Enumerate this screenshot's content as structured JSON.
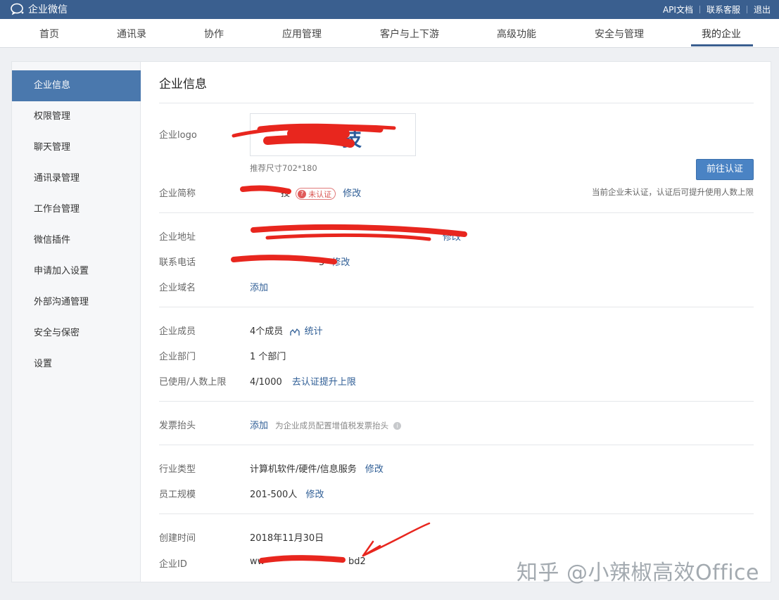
{
  "topbar": {
    "brand": "企业微信",
    "links": [
      "API文档",
      "联系客服",
      "退出"
    ]
  },
  "nav": {
    "items": [
      "首页",
      "通讯录",
      "协作",
      "应用管理",
      "客户与上下游",
      "高级功能",
      "安全与管理",
      "我的企业"
    ],
    "active": "我的企业"
  },
  "sidebar": {
    "items": [
      "企业信息",
      "权限管理",
      "聊天管理",
      "通讯录管理",
      "工作台管理",
      "微信插件",
      "申请加入设置",
      "外部沟通管理",
      "安全与保密",
      "设置"
    ],
    "active": "企业信息"
  },
  "main": {
    "title": "企业信息",
    "logo": {
      "label": "企业logo",
      "image_text": "技",
      "hint": "推荐尺寸702*180"
    },
    "certify_button": "前往认证",
    "cert_note": "当前企业未认证，认证后可提升使用人数上限",
    "short_name": {
      "label": "企业简称",
      "value": "技",
      "badge": "未认证",
      "action": "修改"
    },
    "address": {
      "label": "企业地址",
      "action": "修改"
    },
    "phone": {
      "label": "联系电话",
      "value_tail": "5",
      "action": "修改"
    },
    "domain": {
      "label": "企业域名",
      "action": "添加"
    },
    "members": {
      "label": "企业成员",
      "value": "4个成员",
      "action": "统计"
    },
    "departments": {
      "label": "企业部门",
      "value": "1 个部门"
    },
    "usage": {
      "label": "已使用/人数上限",
      "value": "4/1000",
      "action": "去认证提升上限"
    },
    "invoice": {
      "label": "发票抬头",
      "action": "添加",
      "note": "为企业成员配置增值税发票抬头"
    },
    "industry": {
      "label": "行业类型",
      "value": "计算机软件/硬件/信息服务",
      "action": "修改"
    },
    "scale": {
      "label": "员工规模",
      "value": "201-500人",
      "action": "修改"
    },
    "created": {
      "label": "创建时间",
      "value": "2018年11月30日"
    },
    "corp_id": {
      "label": "企业ID",
      "value_head": "ww",
      "value_tail": "bd2"
    }
  },
  "watermark": "知乎 @小辣椒高效Office",
  "colors": {
    "topbar": "#3a5f8f",
    "accent": "#4a78ad",
    "link": "#2e5d95",
    "scribble": "#e8261e"
  }
}
